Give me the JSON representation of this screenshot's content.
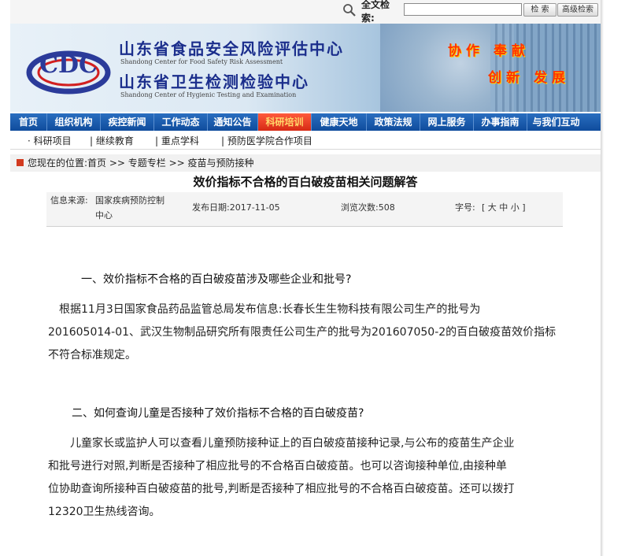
{
  "search": {
    "label": "全文检索:",
    "input_value": "",
    "search_button": "检 索",
    "advanced_button": "高级检索"
  },
  "banner": {
    "title_food_cn": "山东省食品安全风险评估中心",
    "title_food_en": "Shandong Center for Food Safety Risk Assessment",
    "title_hyg_cn": "山东省卫生检测检验中心",
    "title_hyg_en": "Shandong Center of Hygienic Testing and Examination",
    "slogan_1": "协作 奉献",
    "slogan_2": "创新 发展",
    "logo_text": "CDC"
  },
  "nav": {
    "items": [
      "首页",
      "组织机构",
      "疾控新闻",
      "工作动态",
      "通知公告",
      "科研培训",
      "健康天地",
      "政策法规",
      "网上服务",
      "办事指南",
      "与我们互动"
    ],
    "active_index": 5
  },
  "subnav": {
    "items": [
      "· 科研项目",
      "| 继续教育",
      "| 重点学科",
      "| 预防医学院合作项目"
    ]
  },
  "breadcrumb": {
    "text": "您现在的位置:首页 >> 专题专栏 >> 疫苗与预防接种"
  },
  "article": {
    "title": "效价指标不合格的百白破疫苗相关问题解答",
    "source_label": "信息来源:",
    "source_value_1": "国家疾病预防控制",
    "source_value_2": "中心",
    "publish_date": "发布日期:2017-11-05",
    "views": "浏览次数:508",
    "font_size_label": "字号:",
    "font_size_options": "[ 大 中 小 ]",
    "q1": "一、效价指标不合格的百白破疫苗涉及哪些企业和批号?",
    "a1_lines": [
      "根据11月3日国家食品药品监管总局发布信息:长春长生生物科技有限公司生产的批号为",
      "201605014-01、武汉生物制品研究所有限责任公司生产的批号为201607050-2的百白破疫苗效价指标",
      "不符合标准规定。"
    ],
    "q2": "二、如何查询儿童是否接种了效价指标不合格的百白破疫苗?",
    "a2_lines": [
      "儿童家长或监护人可以查看儿童预防接种证上的百白破疫苗接种记录,与公布的疫苗生产企业",
      "和批号进行对照,判断是否接种了相应批号的不合格百白破疫苗。也可以咨询接种单位,由接种单",
      "位协助查询所接种百白破疫苗的批号,判断是否接种了相应批号的不合格百白破疫苗。还可以拨打",
      "12320卫生热线咨询。"
    ]
  },
  "colors": {
    "nav_blue": "#0f4c9c",
    "nav_active": "#d62a14",
    "title_blue": "#1b2e8c",
    "slogan_red": "#ff3300"
  }
}
